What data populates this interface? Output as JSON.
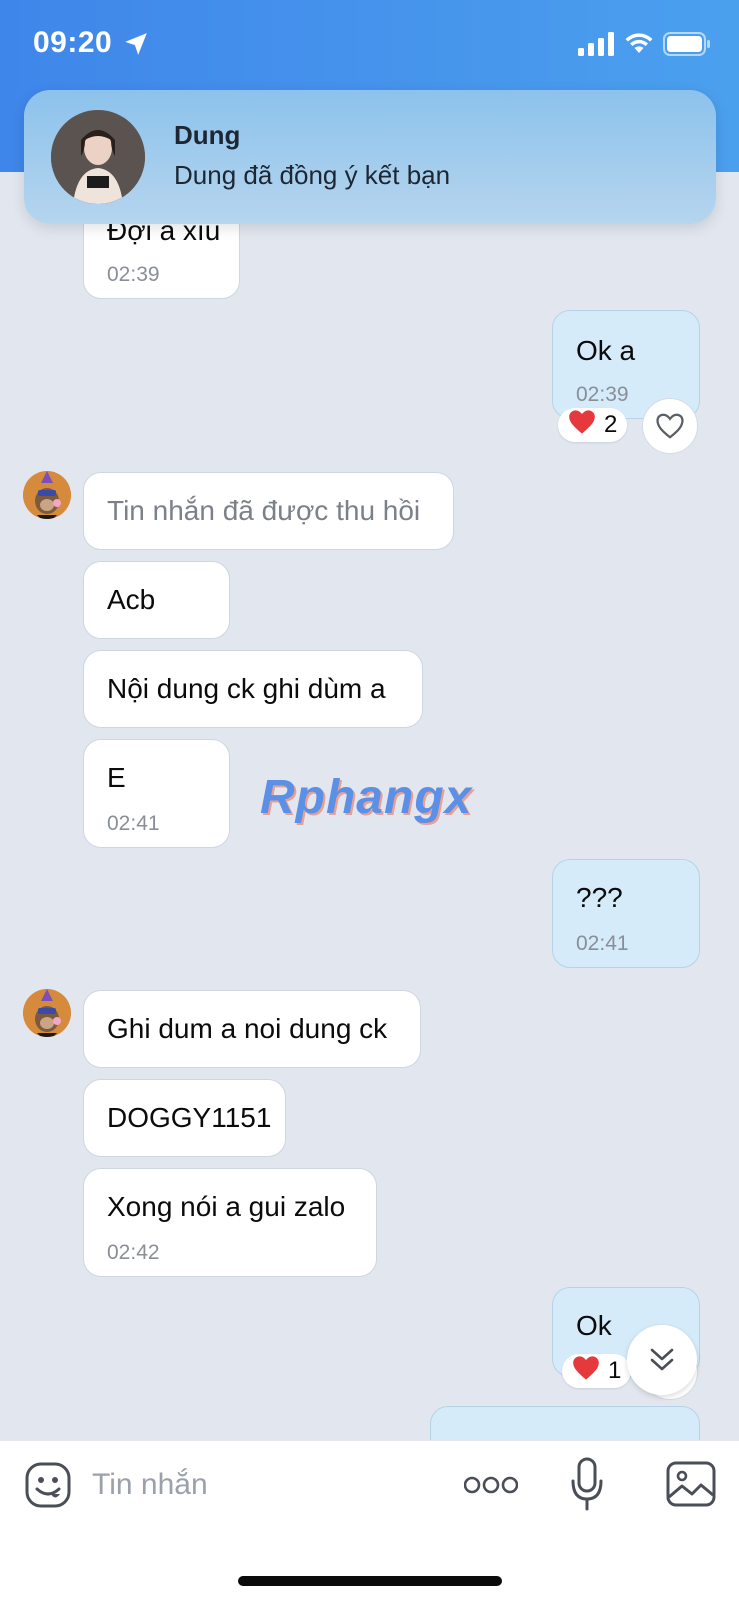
{
  "status_bar": {
    "time": "09:20"
  },
  "notification": {
    "sender": "Dung",
    "text": "Dung đã đồng ý kết bạn"
  },
  "messages": [
    {
      "text": "Đợi a xíu",
      "time": "02:39"
    },
    {
      "text": "Ok a",
      "time": "02:39",
      "reaction": {
        "emoji": "❤️",
        "count": "2"
      }
    },
    {
      "text": "Tin nhắn đã được thu hồi"
    },
    {
      "text": "Acb"
    },
    {
      "text": "Nội dung ck ghi dùm a"
    },
    {
      "text": "E",
      "time": "02:41"
    },
    {
      "text": "???",
      "time": "02:41"
    },
    {
      "text": "Ghi dum a noi dung ck"
    },
    {
      "text": "DOGGY1151"
    },
    {
      "text": "Xong nói a gui zalo",
      "time": "02:42"
    },
    {
      "text": "Ok",
      "reaction": {
        "emoji": "❤️",
        "count": "1"
      }
    }
  ],
  "watermark": "Rphangx",
  "input_bar": {
    "placeholder": "Tin nhắn"
  },
  "colors": {
    "header": "#3f86ea",
    "incoming_bubble": "#ffffff",
    "outgoing_bubble": "#d5ebfa",
    "background": "#e2e7ef"
  }
}
